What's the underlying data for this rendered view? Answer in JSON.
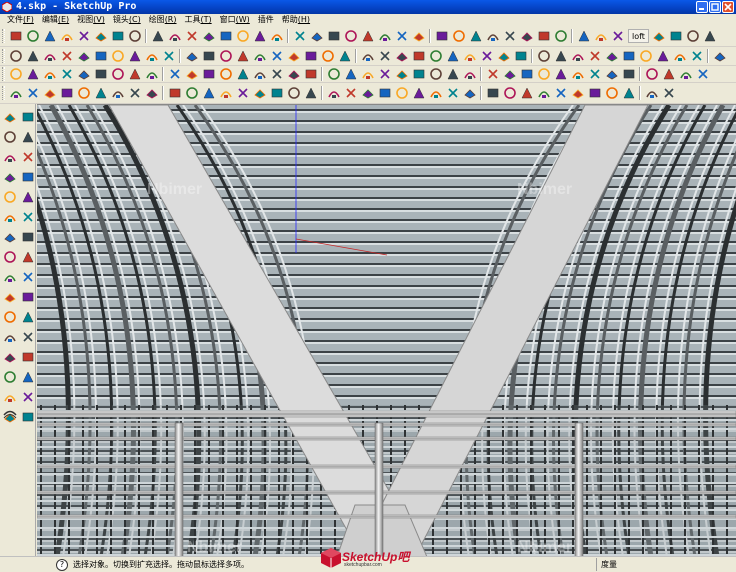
{
  "window": {
    "title": "4.skp - SketchUp Pro"
  },
  "menu": [
    {
      "label": "文件",
      "key": "(F)"
    },
    {
      "label": "编辑",
      "key": "(E)"
    },
    {
      "label": "视图",
      "key": "(V)"
    },
    {
      "label": "镜头",
      "key": "(C)"
    },
    {
      "label": "绘图",
      "key": "(R)"
    },
    {
      "label": "工具",
      "key": "(T)"
    },
    {
      "label": "窗口",
      "key": "(W)"
    },
    {
      "label": "插件",
      "key": ""
    },
    {
      "label": "帮助",
      "key": "(H)"
    }
  ],
  "toolbar": {
    "loft_label": "loft"
  },
  "status": {
    "hint": "选择对象。切换到扩充选择。拖动鼠标选择多项。",
    "measurements_label": "度量"
  },
  "logo": {
    "main": "SketchUp吧",
    "sub": "sketchupbar.com"
  },
  "watermark": {
    "text": "Nbimer"
  },
  "colors": {
    "titlebar": "#0542c4",
    "chrome": "#ece9d8",
    "beam": "#d8d8d8",
    "glass": "#aab5bb",
    "logo_red": "#c8102e"
  }
}
